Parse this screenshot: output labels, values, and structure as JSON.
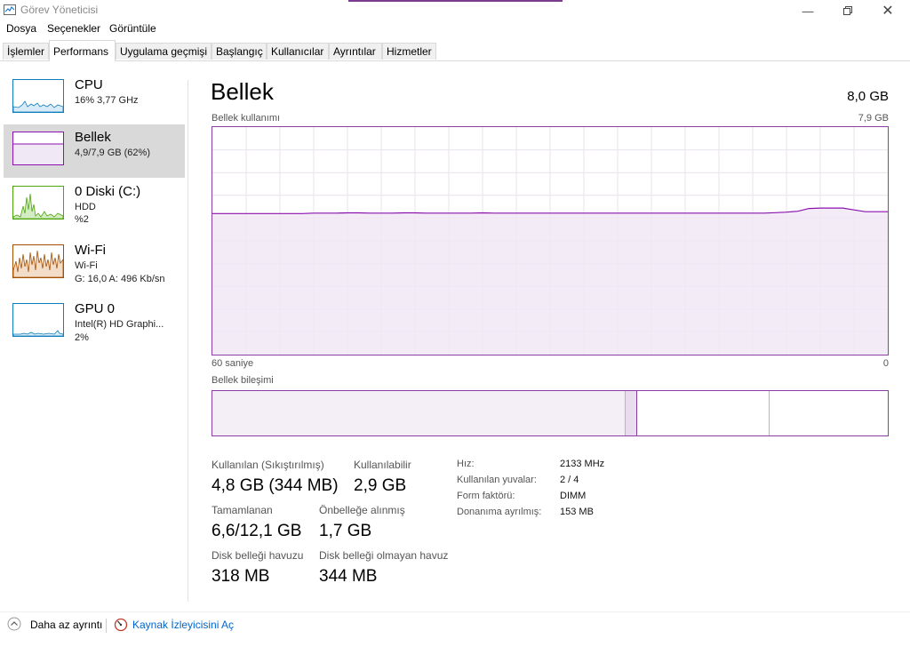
{
  "window": {
    "title": "Görev Yöneticisi"
  },
  "menu": [
    "Dosya",
    "Seçenekler",
    "Görüntüle"
  ],
  "tabs": [
    "İşlemler",
    "Performans",
    "Uygulama geçmişi",
    "Başlangıç",
    "Kullanıcılar",
    "Ayrıntılar",
    "Hizmetler"
  ],
  "active_tab": "Performans",
  "sidebar": [
    {
      "title": "CPU",
      "sub1": "16% 3,77 GHz",
      "sub2": "",
      "color": "#117dbb"
    },
    {
      "title": "Bellek",
      "sub1": "4,9/7,9 GB (62%)",
      "sub2": "",
      "color": "#8b12ae"
    },
    {
      "title": "0 Diski (C:)",
      "sub1": "HDD",
      "sub2": "%2",
      "color": "#4da60c"
    },
    {
      "title": "Wi-Fi",
      "sub1": "Wi-Fi",
      "sub2": "G: 16,0  A: 496 Kb/sn",
      "color": "#a74f01"
    },
    {
      "title": "GPU 0",
      "sub1": "Intel(R) HD Graphi...",
      "sub2": "2%",
      "color": "#117dbb"
    }
  ],
  "main": {
    "title": "Bellek",
    "total": "8,0 GB",
    "graph_label": "Bellek kullanımı",
    "graph_max": "7,9 GB",
    "time_left": "60 saniye",
    "time_right": "0",
    "composition_label": "Bellek bileşimi",
    "usage_fraction": 0.62
  },
  "stats": {
    "used_label": "Kullanılan (Sıkıştırılmış)",
    "used_value": "4,8 GB (344 MB)",
    "available_label": "Kullanılabilir",
    "available_value": "2,9 GB",
    "committed_label": "Tamamlanan",
    "committed_value": "6,6/12,1 GB",
    "cached_label": "Önbelleğe alınmış",
    "cached_value": "1,7 GB",
    "paged_label": "Disk belleği havuzu",
    "paged_value": "318 MB",
    "nonpaged_label": "Disk belleği olmayan havuz",
    "nonpaged_value": "344 MB"
  },
  "info": [
    {
      "label": "Hız:",
      "value": "2133 MHz"
    },
    {
      "label": "Kullanılan yuvalar:",
      "value": "2 / 4"
    },
    {
      "label": "Form faktörü:",
      "value": "DIMM"
    },
    {
      "label": "Donanıma ayrılmış:",
      "value": "153 MB"
    }
  ],
  "footer": {
    "less_details": "Daha az ayrıntı",
    "resource_monitor": "Kaynak İzleyicisini Aç"
  }
}
